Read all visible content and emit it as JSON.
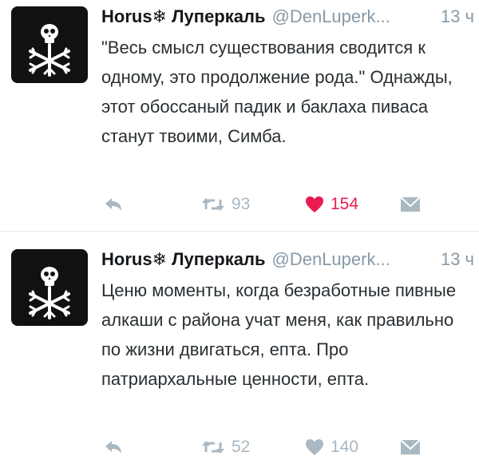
{
  "tweets": [
    {
      "display_name": "Horus❄ Луперкаль",
      "handle": "@DenLuperk...",
      "time": "13 ч",
      "text": "\"Весь смысл существования сводится к одному, это продолжение рода.\" Однажды, этот обоссаный падик и баклаха пиваса станут твоими, Симба.",
      "retweets": "93",
      "likes": "154",
      "liked": true,
      "colors": {
        "like_active": "#e81c4f",
        "icon": "#aab8c2"
      }
    },
    {
      "display_name": "Horus❄ Луперкаль",
      "handle": "@DenLuperk...",
      "time": "13 ч",
      "text": "Ценю моменты, когда безработные пивные алкаши с района учат меня, как правильно по жизни двигаться, епта. Про патриархальные ценности, епта.",
      "retweets": "52",
      "likes": "140",
      "liked": false,
      "colors": {
        "like_active": "#e81c4f",
        "icon": "#aab8c2"
      }
    }
  ],
  "icons": [
    "skull-snowflake-avatar-icon",
    "reply-icon",
    "retweet-icon",
    "heart-icon",
    "direct-message-icon"
  ]
}
